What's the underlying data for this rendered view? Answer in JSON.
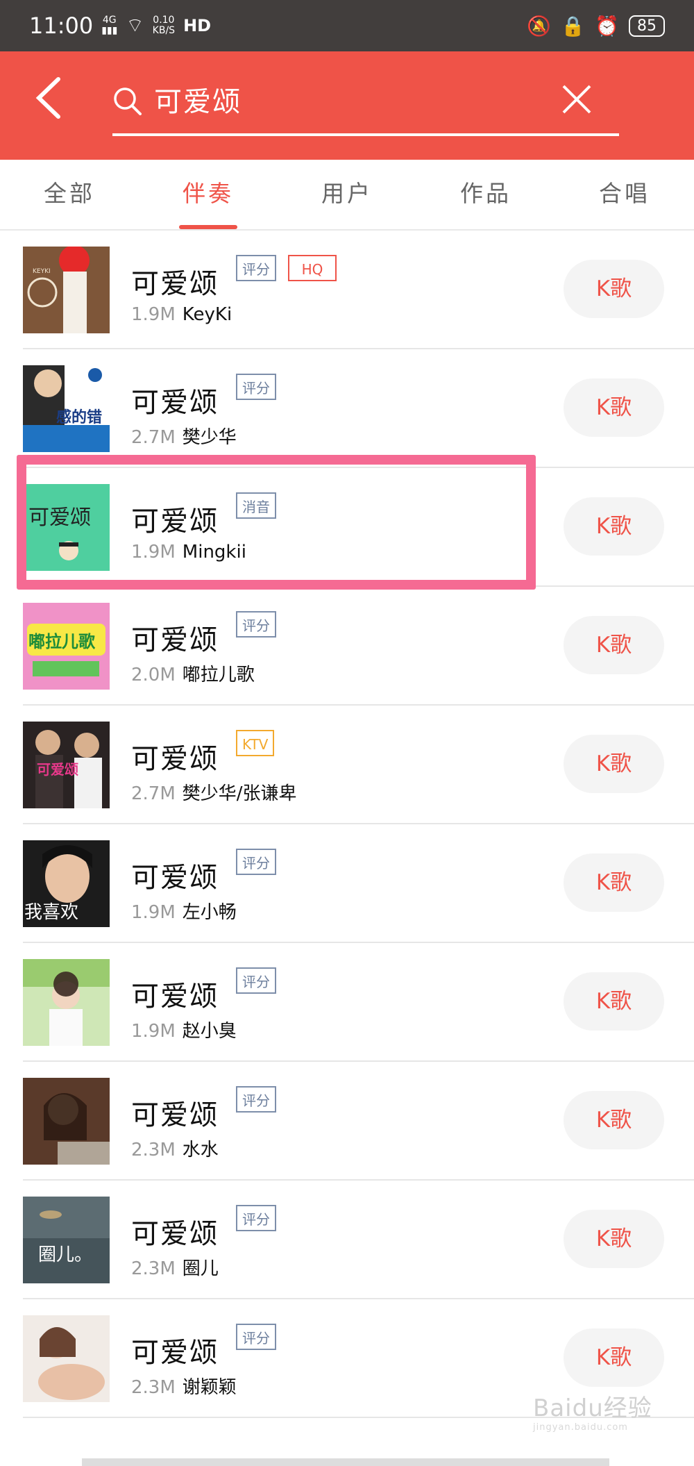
{
  "status": {
    "time": "11:00",
    "net": "4G",
    "speed_top": "0.10",
    "speed_bottom": "KB/S",
    "hd": "HD",
    "battery": "85"
  },
  "search": {
    "query": "可爱颂"
  },
  "tabs": [
    {
      "label": "全部",
      "active": false
    },
    {
      "label": "伴奏",
      "active": true
    },
    {
      "label": "用户",
      "active": false
    },
    {
      "label": "作品",
      "active": false
    },
    {
      "label": "合唱",
      "active": false
    }
  ],
  "songs": [
    {
      "title": "可爱颂",
      "tags": [
        "评分",
        "HQ"
      ],
      "size": "1.9M",
      "artist": "KeyKi",
      "button": "K歌"
    },
    {
      "title": "可爱颂",
      "tags": [
        "评分"
      ],
      "size": "2.7M",
      "artist": "樊少华",
      "button": "K歌"
    },
    {
      "title": "可爱颂",
      "tags": [
        "消音"
      ],
      "size": "1.9M",
      "artist": "Mingkii",
      "button": "K歌"
    },
    {
      "title": "可爱颂",
      "tags": [
        "评分"
      ],
      "size": "2.0M",
      "artist": "嘟拉儿歌",
      "button": "K歌"
    },
    {
      "title": "可爱颂",
      "tags": [
        "KTV"
      ],
      "size": "2.7M",
      "artist": "樊少华/张谦卑",
      "button": "K歌"
    },
    {
      "title": "可爱颂",
      "tags": [
        "评分"
      ],
      "size": "1.9M",
      "artist": "左小畅",
      "button": "K歌"
    },
    {
      "title": "可爱颂",
      "tags": [
        "评分"
      ],
      "size": "1.9M",
      "artist": "赵小臭",
      "button": "K歌"
    },
    {
      "title": "可爱颂",
      "tags": [
        "评分"
      ],
      "size": "2.3M",
      "artist": "水水",
      "button": "K歌"
    },
    {
      "title": "可爱颂",
      "tags": [
        "评分"
      ],
      "size": "2.3M",
      "artist": "圈儿",
      "button": "K歌"
    },
    {
      "title": "可爱颂",
      "tags": [
        "评分"
      ],
      "size": "2.3M",
      "artist": "谢颖颖",
      "button": "K歌"
    }
  ],
  "covers": {
    "c1": "KEYKI",
    "c2": "感的错",
    "c3": "可爱颂",
    "c4": "嘟拉儿歌",
    "c5": "可爱颂",
    "c6": "我喜欢",
    "c9": "圈儿。"
  },
  "watermark": {
    "brand": "Baidu经验",
    "url": "jingyan.baidu.com"
  },
  "colors": {
    "accent": "#ef5348",
    "highlight": "#f56a93"
  }
}
